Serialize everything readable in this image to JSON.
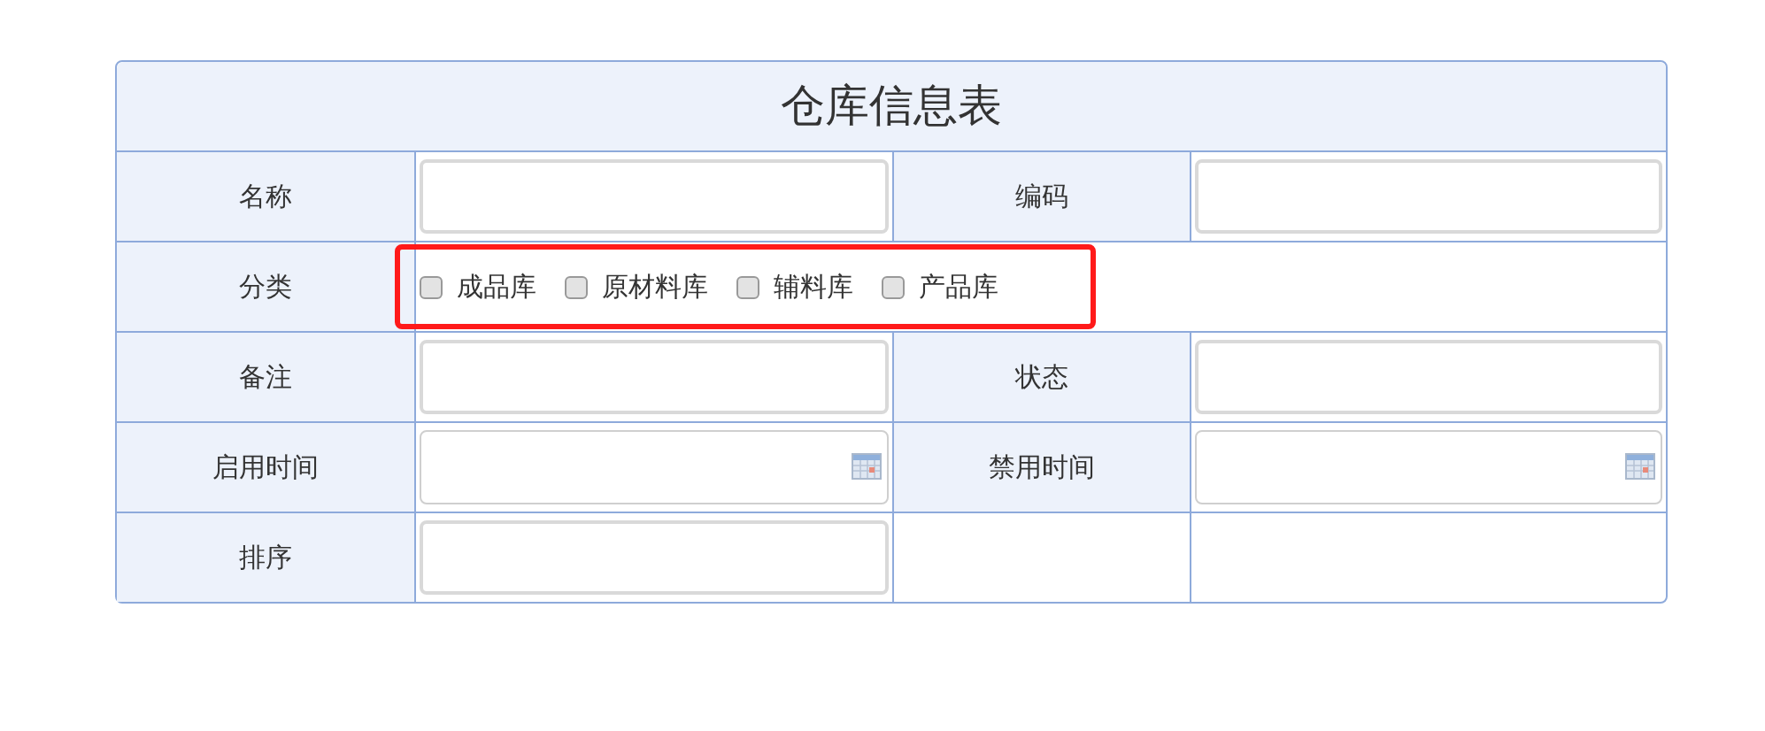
{
  "title": "仓库信息表",
  "rows": [
    {
      "kind": "fields",
      "fields": [
        {
          "label": "名称",
          "kind": "text"
        },
        {
          "label": "编码",
          "kind": "text"
        }
      ]
    },
    {
      "kind": "options",
      "label": "分类",
      "highlighted": true,
      "options": [
        {
          "label": "成品库",
          "checked": false
        },
        {
          "label": "原材料库",
          "checked": false
        },
        {
          "label": "辅料库",
          "checked": false
        },
        {
          "label": "产品库",
          "checked": false
        }
      ]
    },
    {
      "kind": "fields",
      "fields": [
        {
          "label": "备注",
          "kind": "text"
        },
        {
          "label": "状态",
          "kind": "text"
        }
      ]
    },
    {
      "kind": "fields",
      "fields": [
        {
          "label": "启用时间",
          "kind": "date"
        },
        {
          "label": "禁用时间",
          "kind": "date"
        }
      ]
    },
    {
      "kind": "fields",
      "fields": [
        {
          "label": "排序",
          "kind": "text"
        }
      ]
    }
  ]
}
